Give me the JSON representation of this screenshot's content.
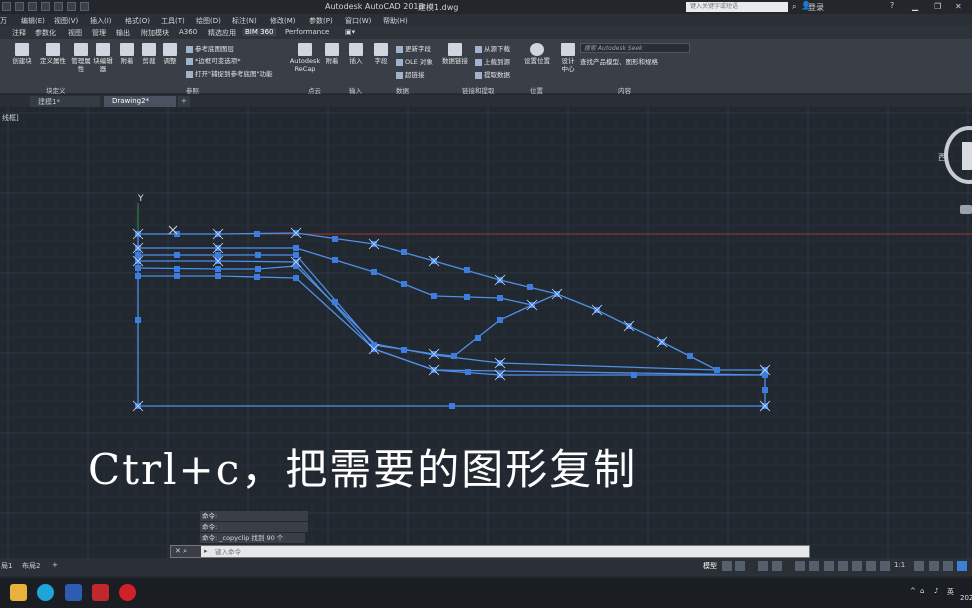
{
  "titlebar": {
    "app_title": "Autodesk AutoCAD 2016",
    "file_name": "建模1.dwg",
    "search_placeholder": "键入关键字或短语",
    "login": "登录"
  },
  "menubar": {
    "items": [
      " 万",
      "编辑(E)",
      "视图(V)",
      "插入(I)",
      "格式(O)",
      "工具(T)",
      "绘图(D)",
      "标注(N)",
      "修改(M)",
      "参数(P)",
      "窗口(W)",
      "帮助(H)"
    ]
  },
  "ribbon_tabs": {
    "items": [
      "注释",
      "参数化",
      "视图",
      "管理",
      "输出",
      "附加模块",
      "A360",
      "精选应用",
      "BIM 360",
      "Performance"
    ],
    "active_index": 8
  },
  "ribbon": {
    "create_block": "创建块",
    "define_attr": "定义属性",
    "manage_attr": "管理属性",
    "block_editor": "块编辑器",
    "attach": "附着",
    "clip": "剪裁",
    "adjust": "调整",
    "underlay_layers": "参考底图图层",
    "frame_var": "*边框可变选项*",
    "snap_ref": "打开\"捕捉到参考底图\"功能",
    "recap": "Autodesk ReCap",
    "attach2": "附着",
    "insert": "插入",
    "field": "字段",
    "update_field": "更新字段",
    "ole": "OLE 对象",
    "hyperlink": "超链接",
    "data_link": "数据链接",
    "download_source": "从源下载",
    "upload_source": "上载到源",
    "extract_data": "提取数据",
    "set_location": "设置位置",
    "design_center": "设计中心",
    "seek_placeholder": "搜索 Autodesk Seek",
    "seek_desc": "查找产品模型、图形和规格"
  },
  "panel_labels": {
    "block_def": "块定义",
    "reference": "参照",
    "point_cloud": "点云",
    "import": "输入",
    "data": "数据",
    "link_extract": "链接和提取",
    "location": "位置",
    "content": "内容"
  },
  "doc_tabs": {
    "items": [
      "建模1*",
      "Drawing2*"
    ],
    "active_index": 1,
    "add": "+"
  },
  "viewport": {
    "label": "线框]",
    "view_direction": "西",
    "axis_label": "Y"
  },
  "caption": "Ctrl+c，把需要的图形复制",
  "command": {
    "history": [
      "命令:",
      "命令:",
      "命令: _copyclip 找到 90 个"
    ],
    "placeholder": "键入命令"
  },
  "layout_tabs": {
    "items": [
      "局1",
      "布局2",
      "+"
    ]
  },
  "statusbar": {
    "model": "模型",
    "scale": "1:1"
  },
  "taskbar": {
    "ime": "英",
    "date": "202"
  },
  "colors": {
    "geometry": "#4f8fe8",
    "grips": "#3d7de0",
    "axis": "#c43c3c",
    "canvas": "#212830"
  }
}
